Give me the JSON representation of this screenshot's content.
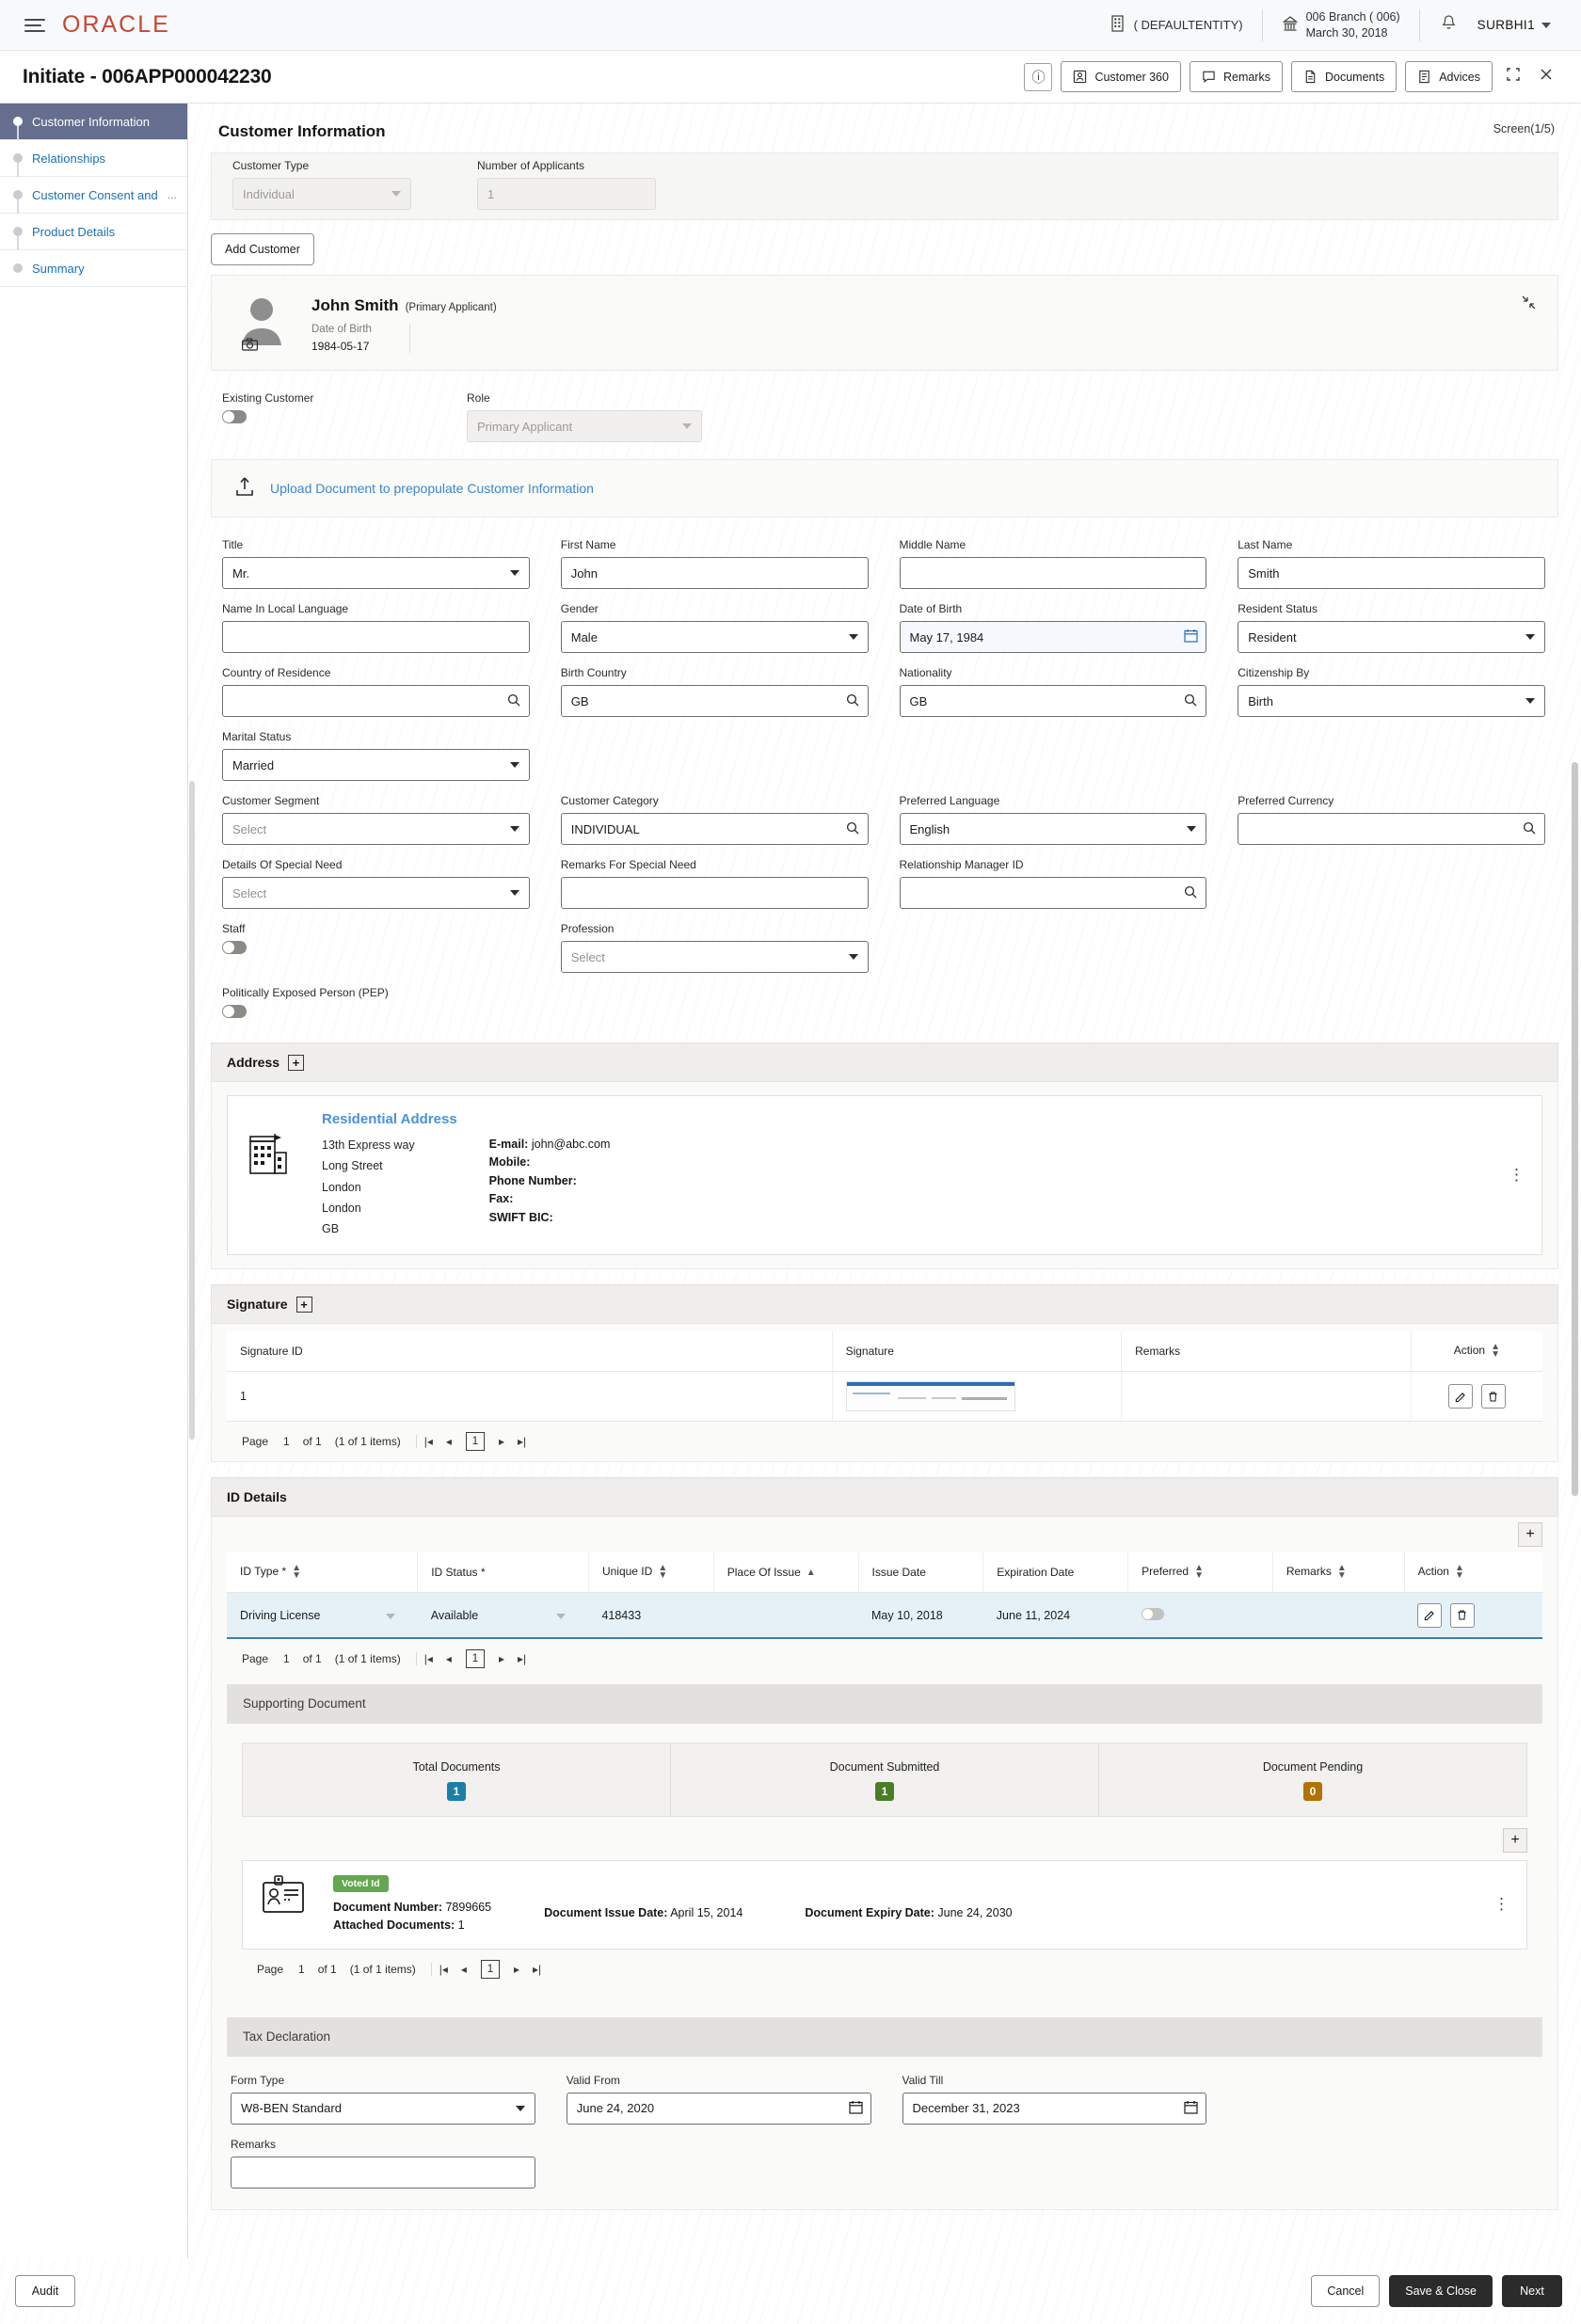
{
  "topbar": {
    "logo": "ORACLE",
    "entity": "( DEFAULTENTITY)",
    "branch_line1": "006 Branch ( 006)",
    "branch_line2": "March 30, 2018",
    "user": "SURBHI1",
    "menu_icon": "hamburger-icon",
    "bell_icon": "bell-icon"
  },
  "header": {
    "title": "Initiate - 006APP000042230",
    "buttons": [
      {
        "label": "Customer 360",
        "icon": "customer-icon"
      },
      {
        "label": "Remarks",
        "icon": "comment-icon"
      },
      {
        "label": "Documents",
        "icon": "document-icon"
      },
      {
        "label": "Advices",
        "icon": "advice-icon"
      }
    ],
    "info_icon": "info-icon",
    "expand_icon": "expand-icon",
    "close_icon": "close-icon"
  },
  "sidebar": {
    "items": [
      {
        "label": "Customer Information",
        "active": true
      },
      {
        "label": "Relationships",
        "active": false
      },
      {
        "label": "Customer Consent and",
        "truncated": "...",
        "active": false
      },
      {
        "label": "Product Details",
        "active": false
      },
      {
        "label": "Summary",
        "active": false
      }
    ]
  },
  "main": {
    "section_title": "Customer Information",
    "screen_count": "Screen(1/5)",
    "customer_type": {
      "label": "Customer Type",
      "value": "Individual"
    },
    "number_of_applicants": {
      "label": "Number of Applicants",
      "value": "1"
    },
    "add_customer_label": "Add Customer",
    "applicant": {
      "name": "John Smith",
      "role_tag": "(Primary Applicant)",
      "dob_label": "Date of Birth",
      "dob_value": "1984-05-17",
      "collapse_icon": "collapse-icon",
      "camera_icon": "camera-icon"
    },
    "existing_customer": {
      "label": "Existing Customer",
      "on": false
    },
    "role": {
      "label": "Role",
      "value": "Primary Applicant"
    },
    "upload_link": "Upload Document to prepopulate Customer Information",
    "fields": {
      "title": {
        "label": "Title",
        "value": "Mr."
      },
      "first_name": {
        "label": "First Name",
        "value": "John"
      },
      "middle_name": {
        "label": "Middle Name",
        "value": ""
      },
      "last_name": {
        "label": "Last Name",
        "value": "Smith"
      },
      "name_local": {
        "label": "Name In Local Language",
        "value": ""
      },
      "gender": {
        "label": "Gender",
        "value": "Male"
      },
      "date_of_birth": {
        "label": "Date of Birth",
        "value": "May 17, 1984"
      },
      "resident_status": {
        "label": "Resident Status",
        "value": "Resident"
      },
      "country_of_residence": {
        "label": "Country of Residence",
        "value": ""
      },
      "birth_country": {
        "label": "Birth Country",
        "value": "GB"
      },
      "nationality": {
        "label": "Nationality",
        "value": "GB"
      },
      "citizenship_by": {
        "label": "Citizenship By",
        "value": "Birth"
      },
      "marital_status": {
        "label": "Marital Status",
        "value": "Married"
      },
      "customer_segment": {
        "label": "Customer Segment",
        "value": "Select"
      },
      "customer_category": {
        "label": "Customer Category",
        "value": "INDIVIDUAL"
      },
      "preferred_language": {
        "label": "Preferred Language",
        "value": "English"
      },
      "preferred_currency": {
        "label": "Preferred Currency",
        "value": ""
      },
      "details_special_need": {
        "label": "Details Of Special Need",
        "value": "Select"
      },
      "remarks_special_need": {
        "label": "Remarks For Special Need",
        "value": ""
      },
      "relationship_manager_id": {
        "label": "Relationship Manager ID",
        "value": ""
      },
      "staff": {
        "label": "Staff",
        "on": false
      },
      "profession": {
        "label": "Profession",
        "value": "Select"
      },
      "pep": {
        "label": "Politically Exposed Person (PEP)",
        "on": false
      }
    },
    "address": {
      "bar_label": "Address",
      "title": "Residential Address",
      "lines": [
        "13th Express way",
        "Long Street",
        "London",
        "London",
        "GB"
      ],
      "contact": [
        {
          "k": "E-mail:",
          "v": "john@abc.com"
        },
        {
          "k": "Mobile:",
          "v": ""
        },
        {
          "k": "Phone Number:",
          "v": ""
        },
        {
          "k": "Fax:",
          "v": ""
        },
        {
          "k": "SWIFT BIC:",
          "v": ""
        }
      ],
      "building_icon": "building-icon",
      "menu_icon": "kebab-menu-icon"
    },
    "signature": {
      "bar_label": "Signature",
      "columns": [
        "Signature ID",
        "Signature",
        "Remarks",
        "Action"
      ],
      "rows": [
        {
          "id": "1",
          "signature": "signature-image",
          "remarks": ""
        }
      ],
      "pager": {
        "page_label": "Page",
        "page": "1",
        "of_label": "of 1",
        "items": "(1 of 1 items)",
        "current": "1"
      },
      "edit_icon": "edit-icon",
      "delete_icon": "delete-icon"
    },
    "id_details": {
      "bar_label": "ID Details",
      "add_icon": "plus-icon",
      "columns": [
        "ID Type *",
        "ID Status *",
        "Unique ID",
        "Place Of Issue",
        "Issue Date",
        "Expiration Date",
        "Preferred",
        "Remarks",
        "Action"
      ],
      "rows": [
        {
          "id_type": "Driving License",
          "id_status": "Available",
          "unique_id": "418433",
          "place_of_issue": "",
          "issue_date": "May 10, 2018",
          "expiration_date": "June 11, 2024",
          "preferred": false,
          "remarks": ""
        }
      ],
      "pager": {
        "page_label": "Page",
        "page": "1",
        "of_label": "of 1",
        "items": "(1 of 1 items)",
        "current": "1"
      }
    },
    "supporting_document": {
      "bar_label": "Supporting Document",
      "stats": [
        {
          "label": "Total Documents",
          "value": "1",
          "color": "#1a7fa8"
        },
        {
          "label": "Document Submitted",
          "value": "1",
          "color": "#4a7d25"
        },
        {
          "label": "Document Pending",
          "value": "0",
          "color": "#b07203"
        }
      ],
      "add_icon": "plus-icon",
      "doc_card": {
        "badge": "Voted Id",
        "doc_number_label": "Document Number:",
        "doc_number": "7899665",
        "attached_label": "Attached Documents:",
        "attached": "1",
        "issue_date_label": "Document Issue Date:",
        "issue_date": "April 15, 2014",
        "expiry_date_label": "Document Expiry Date:",
        "expiry_date": "June 24, 2030",
        "id_card_icon": "id-card-icon",
        "menu_icon": "kebab-menu-icon"
      },
      "pager": {
        "page_label": "Page",
        "page": "1",
        "of_label": "of 1",
        "items": "(1 of 1 items)",
        "current": "1"
      }
    },
    "tax_declaration": {
      "bar_label": "Tax Declaration",
      "form_type": {
        "label": "Form Type",
        "value": "W8-BEN Standard"
      },
      "valid_from": {
        "label": "Valid From",
        "value": "June 24, 2020"
      },
      "valid_till": {
        "label": "Valid Till",
        "value": "December 31, 2023"
      },
      "remarks": {
        "label": "Remarks",
        "value": ""
      }
    }
  },
  "footer": {
    "audit": "Audit",
    "cancel": "Cancel",
    "save_close": "Save & Close",
    "next": "Next"
  }
}
